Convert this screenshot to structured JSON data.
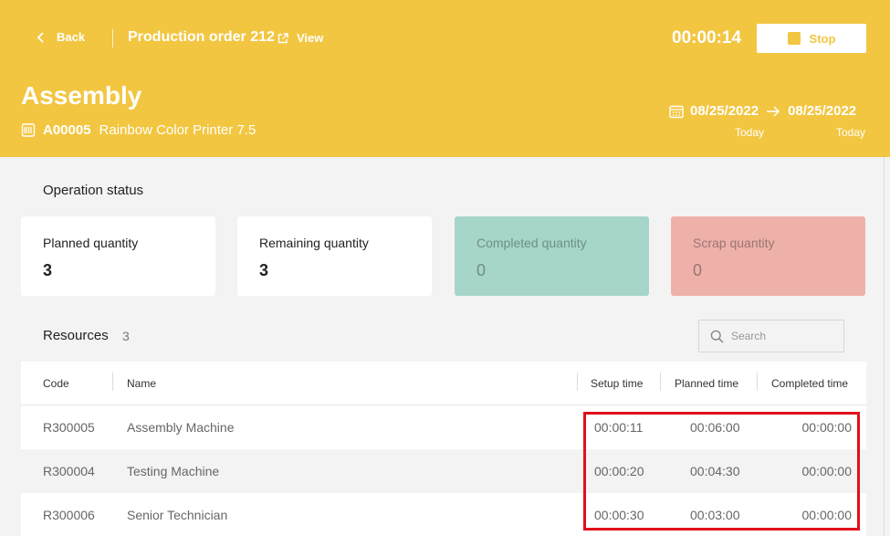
{
  "header": {
    "back_label": "Back",
    "order_title": "Production order 212",
    "view_label": "View",
    "timer": "00:00:14",
    "stop_label": "Stop",
    "operation_title": "Assembly",
    "product_code": "A00005",
    "product_name": "Rainbow Color Printer 7.5",
    "start_date": "08/25/2022",
    "end_date": "08/25/2022",
    "start_caption": "Today",
    "end_caption": "Today",
    "accent_color": "#f2c641"
  },
  "status": {
    "title": "Operation status",
    "cards": [
      {
        "label": "Planned quantity",
        "value": "3",
        "color": "#ffffff"
      },
      {
        "label": "Remaining quantity",
        "value": "3",
        "color": "#ffffff"
      },
      {
        "label": "Completed quantity",
        "value": "0",
        "color": "#a6d5c9"
      },
      {
        "label": "Scrap quantity",
        "value": "0",
        "color": "#eeb1aa"
      }
    ]
  },
  "resources": {
    "title": "Resources",
    "count": "3",
    "search_placeholder": "Search",
    "columns": [
      "Code",
      "Name",
      "Setup time",
      "Planned time",
      "Completed time"
    ],
    "rows": [
      {
        "code": "R300005",
        "name": "Assembly Machine",
        "setup": "00:00:11",
        "planned": "00:06:00",
        "completed": "00:00:00"
      },
      {
        "code": "R300004",
        "name": "Testing Machine",
        "setup": "00:00:20",
        "planned": "00:04:30",
        "completed": "00:00:00"
      },
      {
        "code": "R300006",
        "name": "Senior Technician",
        "setup": "00:00:30",
        "planned": "00:03:00",
        "completed": "00:00:00"
      }
    ]
  },
  "highlight_color": "#e0101b"
}
